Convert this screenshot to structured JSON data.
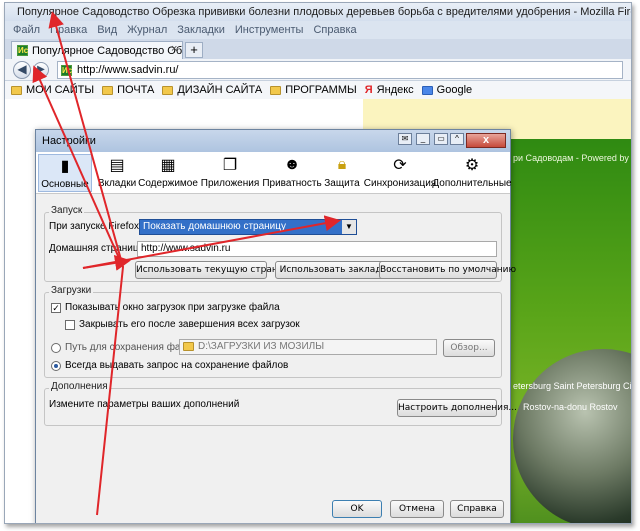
{
  "browser": {
    "title": "Популярное Садоводство Обрезка прививки болезни плодовых деревьев борьба с вредителями удобрения - Mozilla Firefox",
    "menu": [
      "Файл",
      "Правка",
      "Вид",
      "Журнал",
      "Закладки",
      "Инструменты",
      "Справка"
    ],
    "tab_title": "Популярное Садоводство Обрезка пр...",
    "tab_close": "×",
    "new_tab": "+",
    "url": "http://www.sadvin.ru/",
    "bookmarks": [
      {
        "label": "МОИ САЙТЫ",
        "icon": "folder-icon"
      },
      {
        "label": "ПОЧТА",
        "icon": "folder-icon"
      },
      {
        "label": "ДИЗАЙН САЙТА",
        "icon": "folder-icon"
      },
      {
        "label": "ПРОГРАММЫ",
        "icon": "folder-icon"
      },
      {
        "label": "Яндекс",
        "icon": "yandex-icon"
      },
      {
        "label": "Google",
        "icon": "google-icon"
      }
    ]
  },
  "background_page": {
    "caption": "ри Садоводам - Powered by",
    "cities": [
      "etersburg Saint Petersburg Ci",
      "Rostov-na-donu Rostov"
    ]
  },
  "dialog": {
    "title": "Настройки",
    "close": "x",
    "panes": [
      {
        "label": "Основные",
        "icon": "switch-icon",
        "active": true
      },
      {
        "label": "Вкладки",
        "icon": "tabs-icon",
        "active": false
      },
      {
        "label": "Содержимое",
        "icon": "content-icon",
        "active": false
      },
      {
        "label": "Приложения",
        "icon": "applications-icon",
        "active": false
      },
      {
        "label": "Приватность",
        "icon": "mask-icon",
        "active": false
      },
      {
        "label": "Защита",
        "icon": "lock-icon",
        "active": false
      },
      {
        "label": "Синхронизация",
        "icon": "sync-icon",
        "active": false
      },
      {
        "label": "Дополнительные",
        "icon": "gear-icon",
        "active": false
      }
    ],
    "startup": {
      "legend": "Запуск",
      "on_start_label": "При запуске Firefox:",
      "on_start_value": "Показать домашнюю страницу",
      "homepage_label": "Домашняя страница:",
      "homepage_value": "http://www.sadvin.ru",
      "btn_current": "Использовать текущую страницу",
      "btn_bookmark": "Использовать закладку",
      "btn_default": "Восстановить по умолчанию"
    },
    "downloads": {
      "legend": "Загрузки",
      "show_window": "Показывать окно загрузок при загрузке файла",
      "show_window_checked": true,
      "close_after": "Закрывать его после завершения всех загрузок",
      "close_after_checked": false,
      "save_path_label": "Путь для сохранения файлов",
      "save_path_value": "D:\\ЗАГРУЗКИ ИЗ МОЗИЛЫ",
      "browse": "Обзор...",
      "always_ask": "Всегда выдавать запрос на сохранение файлов",
      "selected_option": "always_ask"
    },
    "addons": {
      "legend": "Дополнения",
      "description": "Измените параметры ваших дополнений",
      "button": "Настроить дополнения..."
    },
    "footer": {
      "ok": "OK",
      "cancel": "Отмена",
      "help": "Справка"
    }
  },
  "colors": {
    "annotation_arrow": "#e0262a",
    "select_highlight": "#3370c8"
  }
}
